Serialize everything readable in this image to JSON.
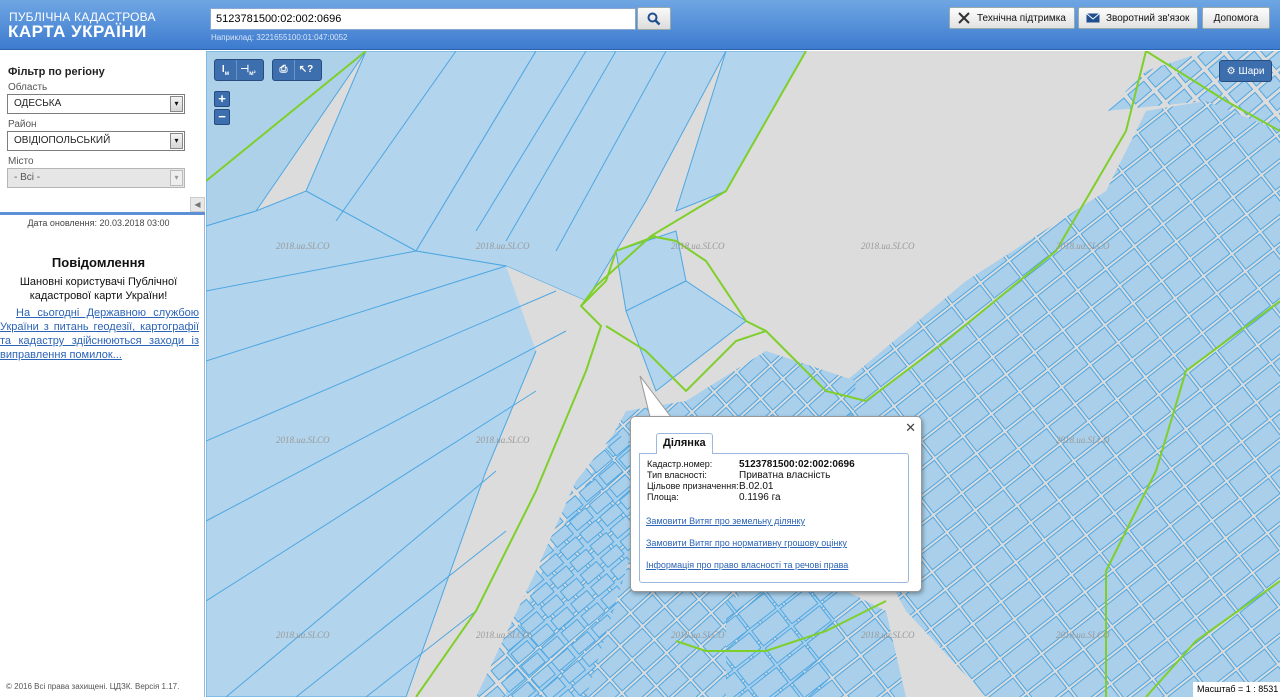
{
  "header": {
    "logo_line1": "ПУБЛІЧНА КАДАСТРОВА",
    "logo_line2": "КАРТА УКРАЇНИ",
    "search_value": "5123781500:02:002:0696",
    "search_hint": "Наприклад: 3221655100:01:047:0052",
    "buttons": {
      "support": "Технічна підтримка",
      "feedback": "Зворотний зв'язок",
      "help": "Допомога"
    }
  },
  "sidebar": {
    "filter_title": "Фільтр по регіону",
    "region_label": "Область",
    "region_value": "ОДЕСЬКА",
    "district_label": "Район",
    "district_value": "ОВІДІОПОЛЬСЬКИЙ",
    "city_label": "Місто",
    "city_value": "- Всі -",
    "update_date": "Дата оновлення: 20.03.2018 03:00",
    "notice_title": "Повідомлення",
    "notice_text": "Шановні користувачі Публічної кадастрової карти України!",
    "notice_link": "На сьогодні Державною службою України з питань геодезії, картографії та кадастру здійснюються заходи із виправлення помилок...",
    "copyright": "© 2016 Всі права захищені. ЦДЗК. Версія 1.17."
  },
  "map": {
    "tools": [
      "I м",
      "⊣ м²",
      "print",
      "pointer-help"
    ],
    "layers_label": "Шари",
    "scale_text": "Масштаб = 1 : 8531",
    "watermark": "2018.ua.SLCO"
  },
  "popup": {
    "tab_label": "Ділянка",
    "rows": [
      {
        "key": "Кадастр.номер:",
        "value": "5123781500:02:002:0696"
      },
      {
        "key": "Тип власності:",
        "value": "Приватна власність"
      },
      {
        "key": "Цільове призначення:",
        "value": "В.02.01"
      },
      {
        "key": "Площа:",
        "value": "0.1196 га"
      }
    ],
    "links": [
      "Замовити Витяг про земельну ділянку",
      "Замовити Витяг про нормативну грошову оцінку",
      "Інформація про право власності та речові права"
    ]
  },
  "colors": {
    "header": "#4a86d6",
    "parcel_fill": "#a9cfea",
    "parcel_stroke": "#5aaee6",
    "boundary": "#7fcf2a",
    "map_bg": "#dcdcdc"
  }
}
